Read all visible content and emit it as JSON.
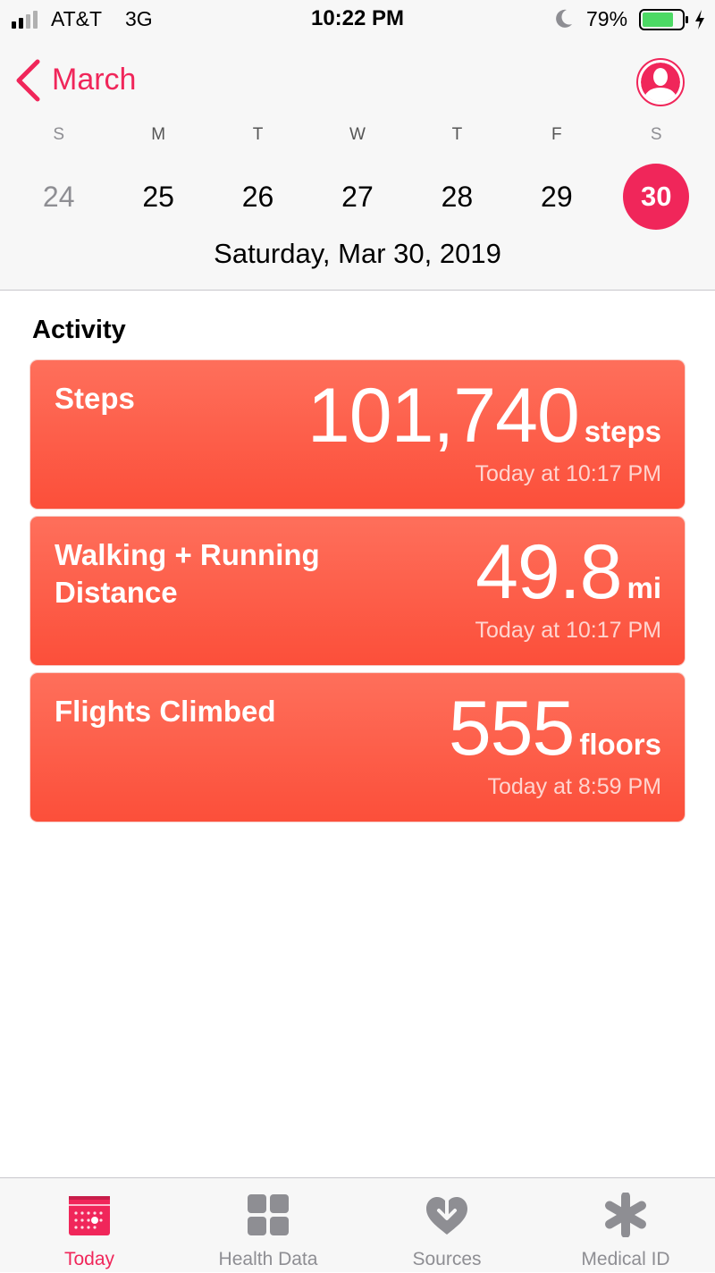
{
  "status_bar": {
    "carrier": "AT&T",
    "network": "3G",
    "time": "10:22 PM",
    "battery_percent": "79%",
    "battery_level": 0.79
  },
  "nav": {
    "back_label": "March"
  },
  "calendar": {
    "weekdays": [
      "S",
      "M",
      "T",
      "W",
      "T",
      "F",
      "S"
    ],
    "dates": [
      "24",
      "25",
      "26",
      "27",
      "28",
      "29",
      "30"
    ],
    "selected_index": 6,
    "full_date": "Saturday, Mar 30, 2019"
  },
  "activity": {
    "section_title": "Activity",
    "cards": [
      {
        "title": "Steps",
        "value": "101,740",
        "unit": "steps",
        "time": "Today at 10:17 PM"
      },
      {
        "title": "Walking + Running Distance",
        "value": "49.8",
        "unit": "mi",
        "time": "Today at 10:17 PM"
      },
      {
        "title": "Flights Climbed",
        "value": "555",
        "unit": "floors",
        "time": "Today at 8:59 PM"
      }
    ]
  },
  "tabbar": {
    "tabs": [
      {
        "label": "Today",
        "icon": "calendar-icon"
      },
      {
        "label": "Health Data",
        "icon": "grid-icon"
      },
      {
        "label": "Sources",
        "icon": "sources-heart-icon"
      },
      {
        "label": "Medical ID",
        "icon": "asterisk-icon"
      }
    ],
    "active_index": 0
  },
  "colors": {
    "accent": "#f0265a",
    "card_top": "#fe6f5b",
    "card_bottom": "#fc4f3a",
    "battery_green": "#4cd964"
  }
}
